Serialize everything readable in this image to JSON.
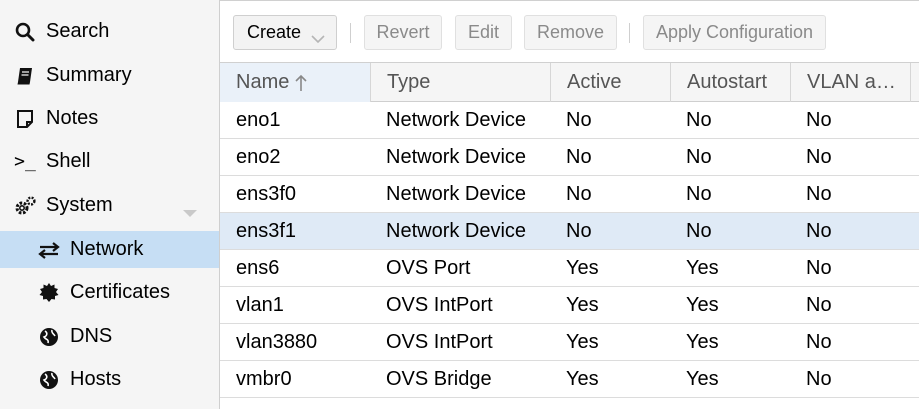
{
  "sidebar": {
    "items": [
      {
        "label": "Search",
        "icon": "search-icon"
      },
      {
        "label": "Summary",
        "icon": "book-icon"
      },
      {
        "label": "Notes",
        "icon": "note-icon"
      },
      {
        "label": "Shell",
        "icon": "terminal-icon"
      },
      {
        "label": "System",
        "icon": "gears-icon"
      },
      {
        "label": "Network",
        "icon": "exchange-icon",
        "selected": true
      },
      {
        "label": "Certificates",
        "icon": "certificate-icon"
      },
      {
        "label": "DNS",
        "icon": "globe-icon"
      },
      {
        "label": "Hosts",
        "icon": "globe-icon"
      }
    ]
  },
  "toolbar": {
    "create_label": "Create",
    "revert_label": "Revert",
    "edit_label": "Edit",
    "remove_label": "Remove",
    "apply_label": "Apply Configuration"
  },
  "grid": {
    "columns": [
      "Name",
      "Type",
      "Active",
      "Autostart",
      "VLAN a…"
    ],
    "sort_column": "Name",
    "rows": [
      {
        "name": "eno1",
        "type": "Network Device",
        "active": "No",
        "autostart": "No",
        "vlan": "No"
      },
      {
        "name": "eno2",
        "type": "Network Device",
        "active": "No",
        "autostart": "No",
        "vlan": "No"
      },
      {
        "name": "ens3f0",
        "type": "Network Device",
        "active": "No",
        "autostart": "No",
        "vlan": "No"
      },
      {
        "name": "ens3f1",
        "type": "Network Device",
        "active": "No",
        "autostart": "No",
        "vlan": "No",
        "selected": true
      },
      {
        "name": "ens6",
        "type": "OVS Port",
        "active": "Yes",
        "autostart": "Yes",
        "vlan": "No"
      },
      {
        "name": "vlan1",
        "type": "OVS IntPort",
        "active": "Yes",
        "autostart": "Yes",
        "vlan": "No"
      },
      {
        "name": "vlan3880",
        "type": "OVS IntPort",
        "active": "Yes",
        "autostart": "Yes",
        "vlan": "No"
      },
      {
        "name": "vmbr0",
        "type": "OVS Bridge",
        "active": "Yes",
        "autostart": "Yes",
        "vlan": "No"
      }
    ]
  },
  "colors": {
    "selected_nav": "#c6def4",
    "selected_row": "#dfeaf6",
    "sidebar_bg": "#f5f5f5"
  }
}
